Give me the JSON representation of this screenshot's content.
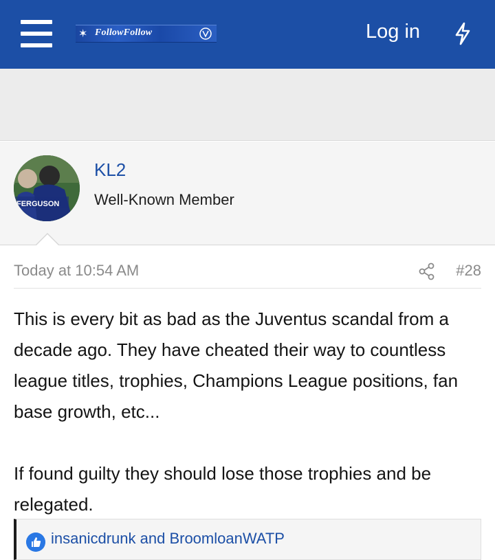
{
  "header": {
    "logo_text": "FollowFollow",
    "login_label": "Log in",
    "colors": {
      "bar": "#1c4fa6",
      "text": "#ffffff"
    }
  },
  "post": {
    "author": {
      "name": "KL2",
      "title": "Well-Known Member",
      "avatar_text": "FERGUSON"
    },
    "date": "Today at 10:54 AM",
    "number": "#28",
    "body": [
      "This is every bit as bad as the Juventus scandal from a decade ago. They have cheated their way to countless league titles, trophies, Champions League positions, fan base growth, etc...",
      "If found guilty they should lose those trophies and be relegated."
    ],
    "reactions": {
      "icon": "like-icon",
      "text": "insanicdrunk and BroomloanWATP"
    }
  }
}
